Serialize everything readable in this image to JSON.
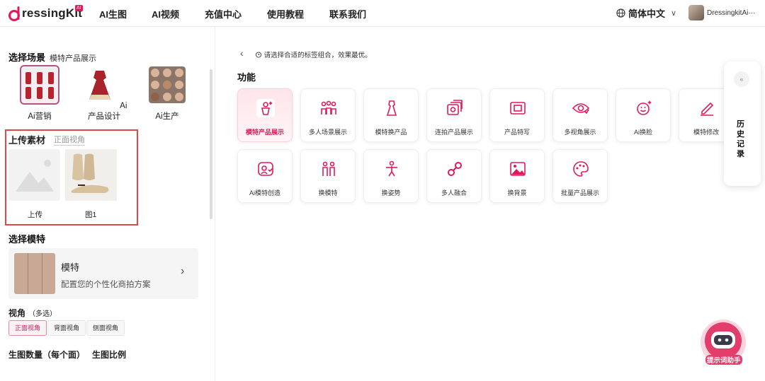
{
  "brand": {
    "name": "ressingKit",
    "badge": "AI",
    "color": "#e2185b"
  },
  "nav": [
    "AI生图",
    "AI视频",
    "充值中心",
    "使用教程",
    "联系我们"
  ],
  "language": "简体中文",
  "user": "DressingkitAi···",
  "sidebar": {
    "scene_title": "选择场景",
    "scene_selected": "模特产品展示",
    "scenes": [
      {
        "label": "Ai营销",
        "active": true
      },
      {
        "label": "Ai产品设计",
        "active": false
      },
      {
        "label": "Ai生产",
        "active": false
      }
    ],
    "upload_title": "上传素材",
    "upload_tab": "正面视角",
    "uploads": [
      {
        "label": "上传"
      },
      {
        "label": "图1"
      }
    ],
    "model_title": "选择模特",
    "model_name": "模特",
    "model_desc": "配置您的个性化商拍方案",
    "angle_title": "视角",
    "angle_note": "（多选）",
    "angles": [
      {
        "label": "正面视角",
        "active": true
      },
      {
        "label": "背面视角",
        "active": false
      },
      {
        "label": "侧面视角",
        "active": false
      }
    ],
    "count_title": "生图数量（每个面）",
    "ratio_title": "生图比例"
  },
  "main": {
    "hint": "请选择合适的标签组合，效果最优。",
    "section_title": "功能",
    "functions": [
      {
        "label": "模特产品展示",
        "icon": "model-product-icon",
        "active": true
      },
      {
        "label": "多人场景展示",
        "icon": "group-icon",
        "active": false
      },
      {
        "label": "模特换产品",
        "icon": "dress-icon",
        "active": false
      },
      {
        "label": "连拍产品展示",
        "icon": "burst-photo-icon",
        "active": false
      },
      {
        "label": "产品特写",
        "icon": "closeup-icon",
        "active": false
      },
      {
        "label": "多视角展示",
        "icon": "multi-view-icon",
        "active": false
      },
      {
        "label": "Ai换脸",
        "icon": "face-swap-icon",
        "active": false
      },
      {
        "label": "模特修改",
        "icon": "edit-icon",
        "active": false
      },
      {
        "label": "Ai模特创造",
        "icon": "model-create-icon",
        "active": false
      },
      {
        "label": "换模特",
        "icon": "swap-model-icon",
        "active": false
      },
      {
        "label": "换姿势",
        "icon": "pose-icon",
        "active": false
      },
      {
        "label": "多人融合",
        "icon": "merge-icon",
        "active": false
      },
      {
        "label": "换背景",
        "icon": "background-icon",
        "active": false
      },
      {
        "label": "批量产品展示",
        "icon": "palette-icon",
        "active": false
      }
    ]
  },
  "history": {
    "collapse": "«",
    "label": "历史记录"
  },
  "assistant": {
    "label": "提示词助手"
  },
  "colors": {
    "accent": "#e2185b",
    "highlight_border": "#d94b4b"
  }
}
